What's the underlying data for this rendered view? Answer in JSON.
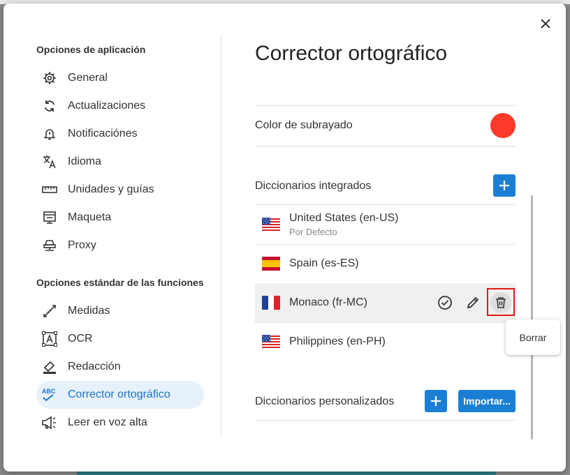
{
  "dialog": {
    "close_icon": "close-icon"
  },
  "sidebar": {
    "app_section_title": "Opciones de aplicación",
    "app_items": [
      {
        "label": "General",
        "icon": "gear-icon"
      },
      {
        "label": "Actualizaciones",
        "icon": "sync-icon"
      },
      {
        "label": "Notificaciónes",
        "icon": "bell-icon"
      },
      {
        "label": "Idioma",
        "icon": "translate-icon"
      },
      {
        "label": "Unidades y guías",
        "icon": "ruler-icon"
      },
      {
        "label": "Maqueta",
        "icon": "layout-icon"
      },
      {
        "label": "Proxy",
        "icon": "proxy-icon"
      }
    ],
    "features_section_title": "Opciones estándar de las funciones",
    "feature_items": [
      {
        "label": "Medidas",
        "icon": "measure-icon"
      },
      {
        "label": "OCR",
        "icon": "ocr-icon"
      },
      {
        "label": "Redacción",
        "icon": "eraser-icon"
      },
      {
        "label": "Corrector ortográfico",
        "icon": "spellcheck-icon",
        "active": true
      },
      {
        "label": "Leer en voz alta",
        "icon": "megaphone-icon"
      }
    ]
  },
  "main": {
    "title": "Corrector ortográfico",
    "underline_color_label": "Color de subrayado",
    "underline_color": "#ff3a2a",
    "builtin_title": "Diccionarios integrados",
    "dictionaries": [
      {
        "name": "United States (en-US)",
        "subtitle": "Por Defecto",
        "flag": "us"
      },
      {
        "name": "Spain (es-ES)",
        "subtitle": "",
        "flag": "es"
      },
      {
        "name": "Monaco (fr-MC)",
        "subtitle": "",
        "flag": "fr",
        "selected": true
      },
      {
        "name": "Philippines (en-PH)",
        "subtitle": "",
        "flag": "us"
      }
    ],
    "custom_title": "Diccionarios personalizados",
    "import_label": "Importar...",
    "tooltip": "Borrar"
  },
  "colors": {
    "accent": "#1a7fd4",
    "highlight": "#e01818"
  }
}
